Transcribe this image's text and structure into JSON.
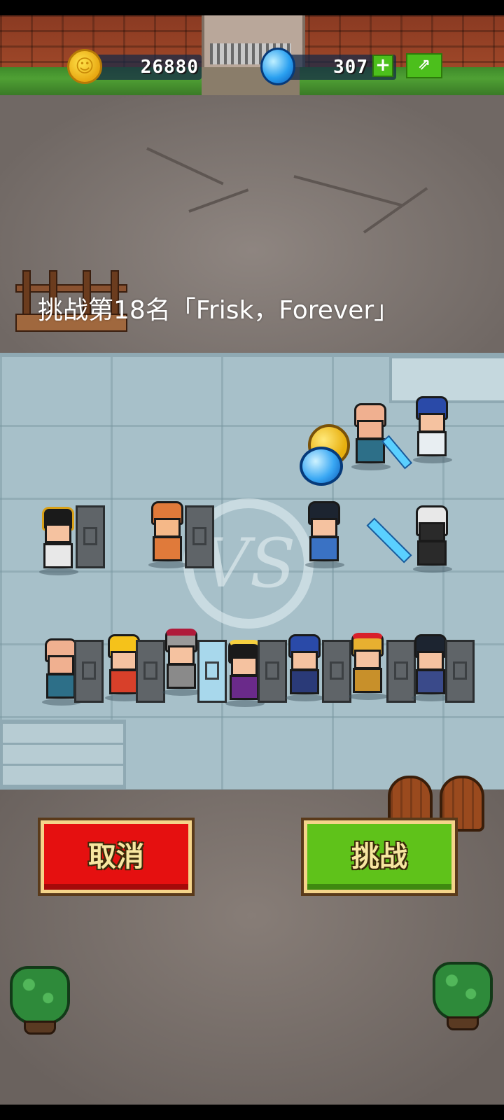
{
  "hud": {
    "gold_amount": "26880",
    "gem_amount": "307",
    "add_label": "+",
    "share_icon": "share-arrow-icon"
  },
  "challenge": {
    "title": "挑战第18名「Frisk，Forever」"
  },
  "buttons": {
    "cancel_label": "取消",
    "challenge_label": "挑战"
  },
  "arena": {
    "vs_label": "VS"
  },
  "colors": {
    "cancel": "#e51010",
    "challenge": "#5fc21a",
    "arena": "#a7c0c9"
  }
}
